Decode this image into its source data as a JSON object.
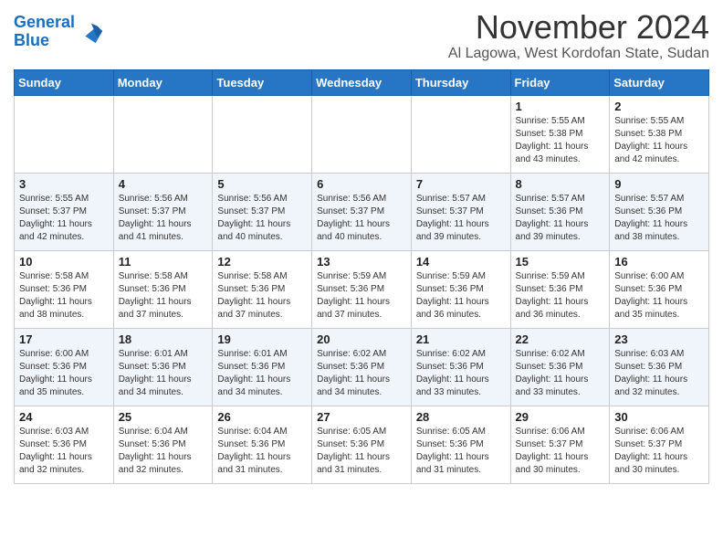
{
  "header": {
    "logo_line1": "General",
    "logo_line2": "Blue",
    "month": "November 2024",
    "location": "Al Lagowa, West Kordofan State, Sudan"
  },
  "weekdays": [
    "Sunday",
    "Monday",
    "Tuesday",
    "Wednesday",
    "Thursday",
    "Friday",
    "Saturday"
  ],
  "weeks": [
    [
      {
        "day": "",
        "info": ""
      },
      {
        "day": "",
        "info": ""
      },
      {
        "day": "",
        "info": ""
      },
      {
        "day": "",
        "info": ""
      },
      {
        "day": "",
        "info": ""
      },
      {
        "day": "1",
        "info": "Sunrise: 5:55 AM\nSunset: 5:38 PM\nDaylight: 11 hours\nand 43 minutes."
      },
      {
        "day": "2",
        "info": "Sunrise: 5:55 AM\nSunset: 5:38 PM\nDaylight: 11 hours\nand 42 minutes."
      }
    ],
    [
      {
        "day": "3",
        "info": "Sunrise: 5:55 AM\nSunset: 5:37 PM\nDaylight: 11 hours\nand 42 minutes."
      },
      {
        "day": "4",
        "info": "Sunrise: 5:56 AM\nSunset: 5:37 PM\nDaylight: 11 hours\nand 41 minutes."
      },
      {
        "day": "5",
        "info": "Sunrise: 5:56 AM\nSunset: 5:37 PM\nDaylight: 11 hours\nand 40 minutes."
      },
      {
        "day": "6",
        "info": "Sunrise: 5:56 AM\nSunset: 5:37 PM\nDaylight: 11 hours\nand 40 minutes."
      },
      {
        "day": "7",
        "info": "Sunrise: 5:57 AM\nSunset: 5:37 PM\nDaylight: 11 hours\nand 39 minutes."
      },
      {
        "day": "8",
        "info": "Sunrise: 5:57 AM\nSunset: 5:36 PM\nDaylight: 11 hours\nand 39 minutes."
      },
      {
        "day": "9",
        "info": "Sunrise: 5:57 AM\nSunset: 5:36 PM\nDaylight: 11 hours\nand 38 minutes."
      }
    ],
    [
      {
        "day": "10",
        "info": "Sunrise: 5:58 AM\nSunset: 5:36 PM\nDaylight: 11 hours\nand 38 minutes."
      },
      {
        "day": "11",
        "info": "Sunrise: 5:58 AM\nSunset: 5:36 PM\nDaylight: 11 hours\nand 37 minutes."
      },
      {
        "day": "12",
        "info": "Sunrise: 5:58 AM\nSunset: 5:36 PM\nDaylight: 11 hours\nand 37 minutes."
      },
      {
        "day": "13",
        "info": "Sunrise: 5:59 AM\nSunset: 5:36 PM\nDaylight: 11 hours\nand 37 minutes."
      },
      {
        "day": "14",
        "info": "Sunrise: 5:59 AM\nSunset: 5:36 PM\nDaylight: 11 hours\nand 36 minutes."
      },
      {
        "day": "15",
        "info": "Sunrise: 5:59 AM\nSunset: 5:36 PM\nDaylight: 11 hours\nand 36 minutes."
      },
      {
        "day": "16",
        "info": "Sunrise: 6:00 AM\nSunset: 5:36 PM\nDaylight: 11 hours\nand 35 minutes."
      }
    ],
    [
      {
        "day": "17",
        "info": "Sunrise: 6:00 AM\nSunset: 5:36 PM\nDaylight: 11 hours\nand 35 minutes."
      },
      {
        "day": "18",
        "info": "Sunrise: 6:01 AM\nSunset: 5:36 PM\nDaylight: 11 hours\nand 34 minutes."
      },
      {
        "day": "19",
        "info": "Sunrise: 6:01 AM\nSunset: 5:36 PM\nDaylight: 11 hours\nand 34 minutes."
      },
      {
        "day": "20",
        "info": "Sunrise: 6:02 AM\nSunset: 5:36 PM\nDaylight: 11 hours\nand 34 minutes."
      },
      {
        "day": "21",
        "info": "Sunrise: 6:02 AM\nSunset: 5:36 PM\nDaylight: 11 hours\nand 33 minutes."
      },
      {
        "day": "22",
        "info": "Sunrise: 6:02 AM\nSunset: 5:36 PM\nDaylight: 11 hours\nand 33 minutes."
      },
      {
        "day": "23",
        "info": "Sunrise: 6:03 AM\nSunset: 5:36 PM\nDaylight: 11 hours\nand 32 minutes."
      }
    ],
    [
      {
        "day": "24",
        "info": "Sunrise: 6:03 AM\nSunset: 5:36 PM\nDaylight: 11 hours\nand 32 minutes."
      },
      {
        "day": "25",
        "info": "Sunrise: 6:04 AM\nSunset: 5:36 PM\nDaylight: 11 hours\nand 32 minutes."
      },
      {
        "day": "26",
        "info": "Sunrise: 6:04 AM\nSunset: 5:36 PM\nDaylight: 11 hours\nand 31 minutes."
      },
      {
        "day": "27",
        "info": "Sunrise: 6:05 AM\nSunset: 5:36 PM\nDaylight: 11 hours\nand 31 minutes."
      },
      {
        "day": "28",
        "info": "Sunrise: 6:05 AM\nSunset: 5:36 PM\nDaylight: 11 hours\nand 31 minutes."
      },
      {
        "day": "29",
        "info": "Sunrise: 6:06 AM\nSunset: 5:37 PM\nDaylight: 11 hours\nand 30 minutes."
      },
      {
        "day": "30",
        "info": "Sunrise: 6:06 AM\nSunset: 5:37 PM\nDaylight: 11 hours\nand 30 minutes."
      }
    ]
  ]
}
